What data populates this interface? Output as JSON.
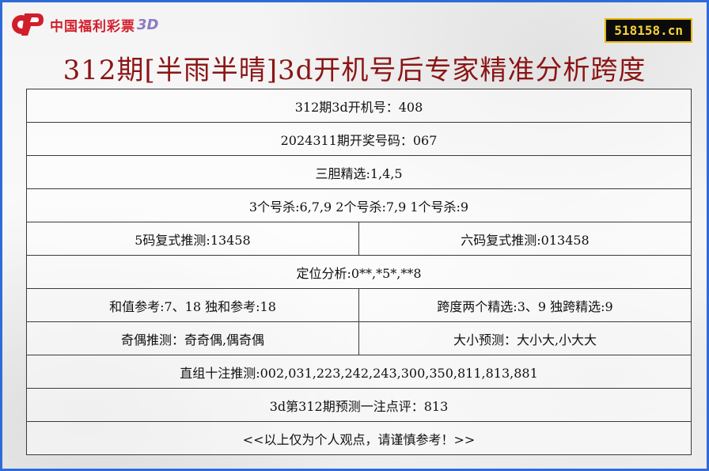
{
  "logo": {
    "text": "中国福利彩票",
    "suffix": "3D"
  },
  "site_badge": "518158.cn",
  "title": "312期[半雨半晴]3d开机号后专家精准分析跨度",
  "rows": {
    "r1": "312期3d开机号：408",
    "r2": "2024311期开奖号码：067",
    "r3": "三胆精选:1,4,5",
    "r4": "3个号杀:6,7,9  2个号杀:7,9  1个号杀:9",
    "r5_left": "5码复式推测:13458",
    "r5_right": "六码复式推测:013458",
    "r6": "定位分析:0**,*5*,**8",
    "r7_left": "和值参考:7、18 独和参考:18",
    "r7_right": "跨度两个精选:3、9  独跨精选:9",
    "r8_left": "奇偶推测：奇奇偶,偶奇偶",
    "r8_right": "大小预测：大小大,小大大",
    "r9": "直组十注推测:002,031,223,242,243,300,350,811,813,881",
    "r10": "3d第312期预测一注点评：813",
    "r11": "<<以上仅为个人观点，请谨慎参考！>>"
  },
  "colors": {
    "frame_border": "#2f6bd8",
    "title": "#8b1515",
    "logo_red": "#d21e2b",
    "badge_bg": "#0b0b0b",
    "badge_text": "#f6d23a"
  }
}
